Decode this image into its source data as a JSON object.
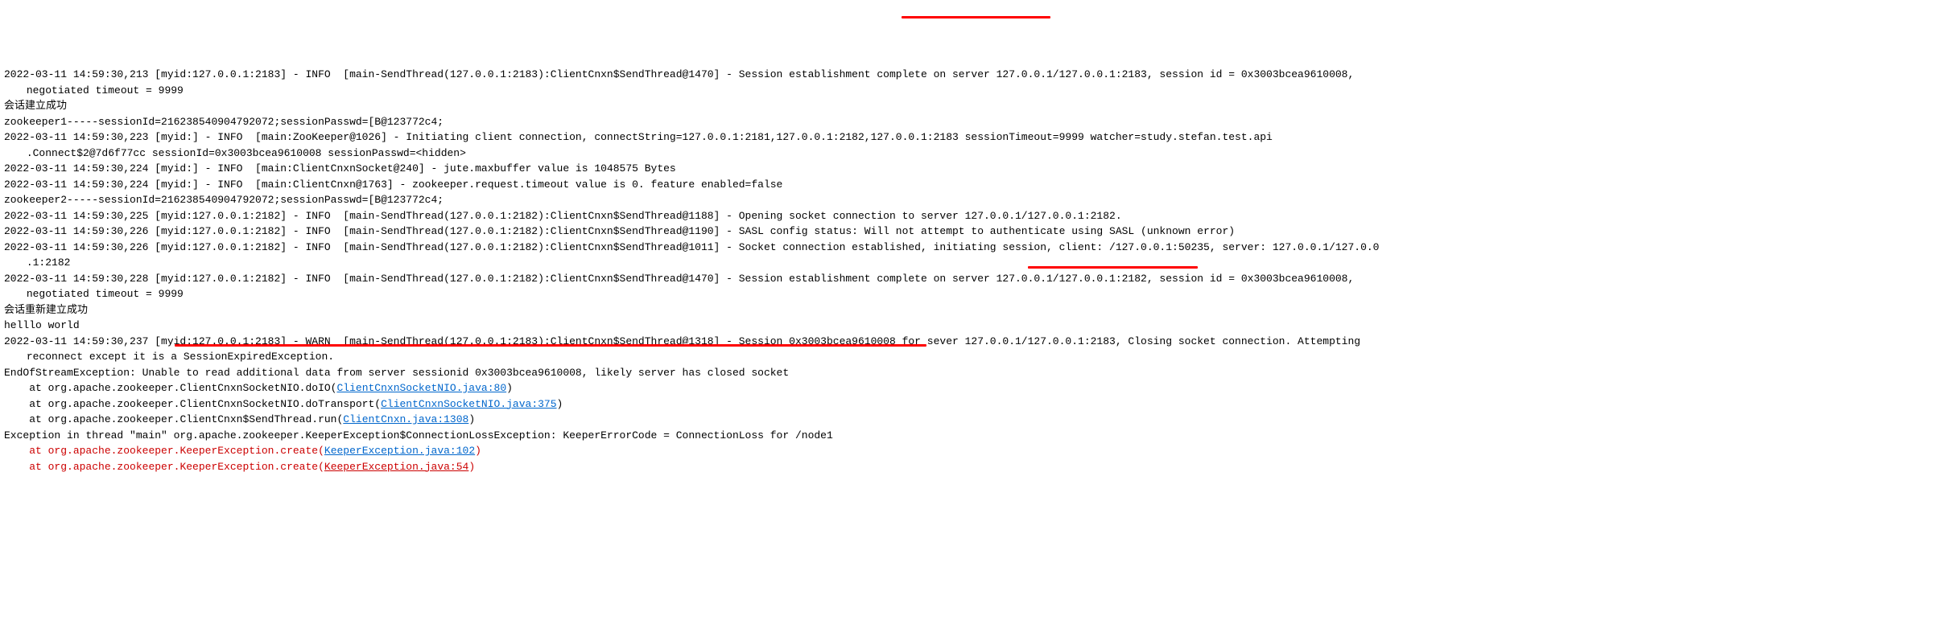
{
  "lines": {
    "l1": "2022-03-11 14:59:30,213 [myid:127.0.0.1:2183] - INFO  [main-SendThread(127.0.0.1:2183):ClientCnxn$SendThread@1470] - Session establishment complete on server 127.0.0.1/127.0.0.1:2183, session id = 0x3003bcea9610008,",
    "l2": " negotiated timeout = 9999",
    "l3": "会话建立成功",
    "l4": "zookeeper1-----sessionId=216238540904792072;sessionPasswd=[B@123772c4;",
    "l5": "2022-03-11 14:59:30,223 [myid:] - INFO  [main:ZooKeeper@1026] - Initiating client connection, connectString=127.0.0.1:2181,127.0.0.1:2182,127.0.0.1:2183 sessionTimeout=9999 watcher=study.stefan.test.api",
    "l6": " .Connect$2@7d6f77cc sessionId=0x3003bcea9610008 sessionPasswd=<hidden>",
    "l7": "2022-03-11 14:59:30,224 [myid:] - INFO  [main:ClientCnxnSocket@240] - jute.maxbuffer value is 1048575 Bytes",
    "l8": "2022-03-11 14:59:30,224 [myid:] - INFO  [main:ClientCnxn@1763] - zookeeper.request.timeout value is 0. feature enabled=false",
    "l9": "zookeeper2-----sessionId=216238540904792072;sessionPasswd=[B@123772c4;",
    "l10": "2022-03-11 14:59:30,225 [myid:127.0.0.1:2182] - INFO  [main-SendThread(127.0.0.1:2182):ClientCnxn$SendThread@1188] - Opening socket connection to server 127.0.0.1/127.0.0.1:2182.",
    "l11": "2022-03-11 14:59:30,226 [myid:127.0.0.1:2182] - INFO  [main-SendThread(127.0.0.1:2182):ClientCnxn$SendThread@1190] - SASL config status: Will not attempt to authenticate using SASL (unknown error)",
    "l12": "2022-03-11 14:59:30,226 [myid:127.0.0.1:2182] - INFO  [main-SendThread(127.0.0.1:2182):ClientCnxn$SendThread@1011] - Socket connection established, initiating session, client: /127.0.0.1:50235, server: 127.0.0.1/127.0.0",
    "l13": " .1:2182",
    "l14": "2022-03-11 14:59:30,228 [myid:127.0.0.1:2182] - INFO  [main-SendThread(127.0.0.1:2182):ClientCnxn$SendThread@1470] - Session establishment complete on server 127.0.0.1/127.0.0.1:2182, session id = 0x3003bcea9610008,",
    "l15": " negotiated timeout = 9999",
    "l16": "会话重新建立成功",
    "l17": "helllo world",
    "l18": "2022-03-11 14:59:30,237 [myid:127.0.0.1:2183] - WARN  [main-SendThread(127.0.0.1:2183):ClientCnxn$SendThread@1318] - Session 0x3003bcea9610008 for sever 127.0.0.1/127.0.0.1:2183, Closing socket connection. Attempting",
    "l19": " reconnect except it is a SessionExpiredException.",
    "l20": "EndOfStreamException: Unable to read additional data from server sessionid 0x3003bcea9610008, likely server has closed socket",
    "l21a": "    at org.apache.zookeeper.ClientCnxnSocketNIO.doIO(",
    "l21b": "ClientCnxnSocketNIO.java:80",
    "l21c": ")",
    "l22a": "    at org.apache.zookeeper.ClientCnxnSocketNIO.doTransport(",
    "l22b": "ClientCnxnSocketNIO.java:375",
    "l22c": ")",
    "l23a": "    at org.apache.zookeeper.ClientCnxn$SendThread.run(",
    "l23b": "ClientCnxn.java:1308",
    "l23c": ")",
    "l24": "Exception in thread \"main\" org.apache.zookeeper.KeeperException$ConnectionLossException: KeeperErrorCode = ConnectionLoss for /node1",
    "l25a": "    at org.apache.zookeeper.KeeperException.create(",
    "l25b": "KeeperException.java:102",
    "l25c": ")",
    "l26a": "    at org.apache.zookeeper.KeeperException.create(",
    "l26b": "KeeperException.java:54",
    "l26c": ")"
  }
}
